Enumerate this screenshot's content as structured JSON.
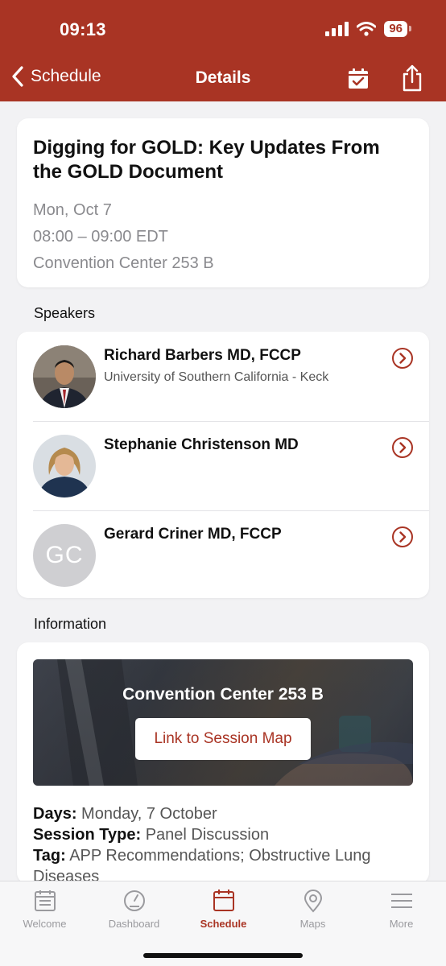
{
  "status": {
    "time": "09:13",
    "battery": "96"
  },
  "nav": {
    "back_label": "Schedule",
    "title": "Details"
  },
  "session": {
    "title": "Digging for GOLD: Key Updates From the GOLD Document",
    "date": "Mon, Oct 7",
    "time": "08:00 – 09:00 EDT",
    "location": "Convention Center 253 B"
  },
  "speakers_heading": "Speakers",
  "speakers": [
    {
      "name": "Richard Barbers MD, FCCP",
      "affiliation": "University of Southern California - Keck"
    },
    {
      "name": "Stephanie Christenson MD",
      "affiliation": ""
    },
    {
      "name": "Gerard Criner MD, FCCP",
      "affiliation": "",
      "initials": "GC"
    }
  ],
  "information_heading": "Information",
  "information": {
    "banner_location": "Convention Center 253 B",
    "map_button": "Link to Session Map",
    "days_label": "Days:",
    "days_value": "Monday, 7 October",
    "type_label": "Session Type:",
    "type_value": "Panel Discussion",
    "tag_label": "Tag:",
    "tag_value": "APP Recommendations; Obstructive Lung Diseases"
  },
  "tabs": [
    {
      "label": "Welcome",
      "icon": "welcome-icon"
    },
    {
      "label": "Dashboard",
      "icon": "dashboard-icon"
    },
    {
      "label": "Schedule",
      "icon": "calendar-icon",
      "active": true
    },
    {
      "label": "Maps",
      "icon": "map-pin-icon"
    },
    {
      "label": "More",
      "icon": "menu-icon"
    }
  ],
  "colors": {
    "brand": "#a93424",
    "background": "#f2f2f4",
    "muted_text": "#8a8a8e"
  }
}
